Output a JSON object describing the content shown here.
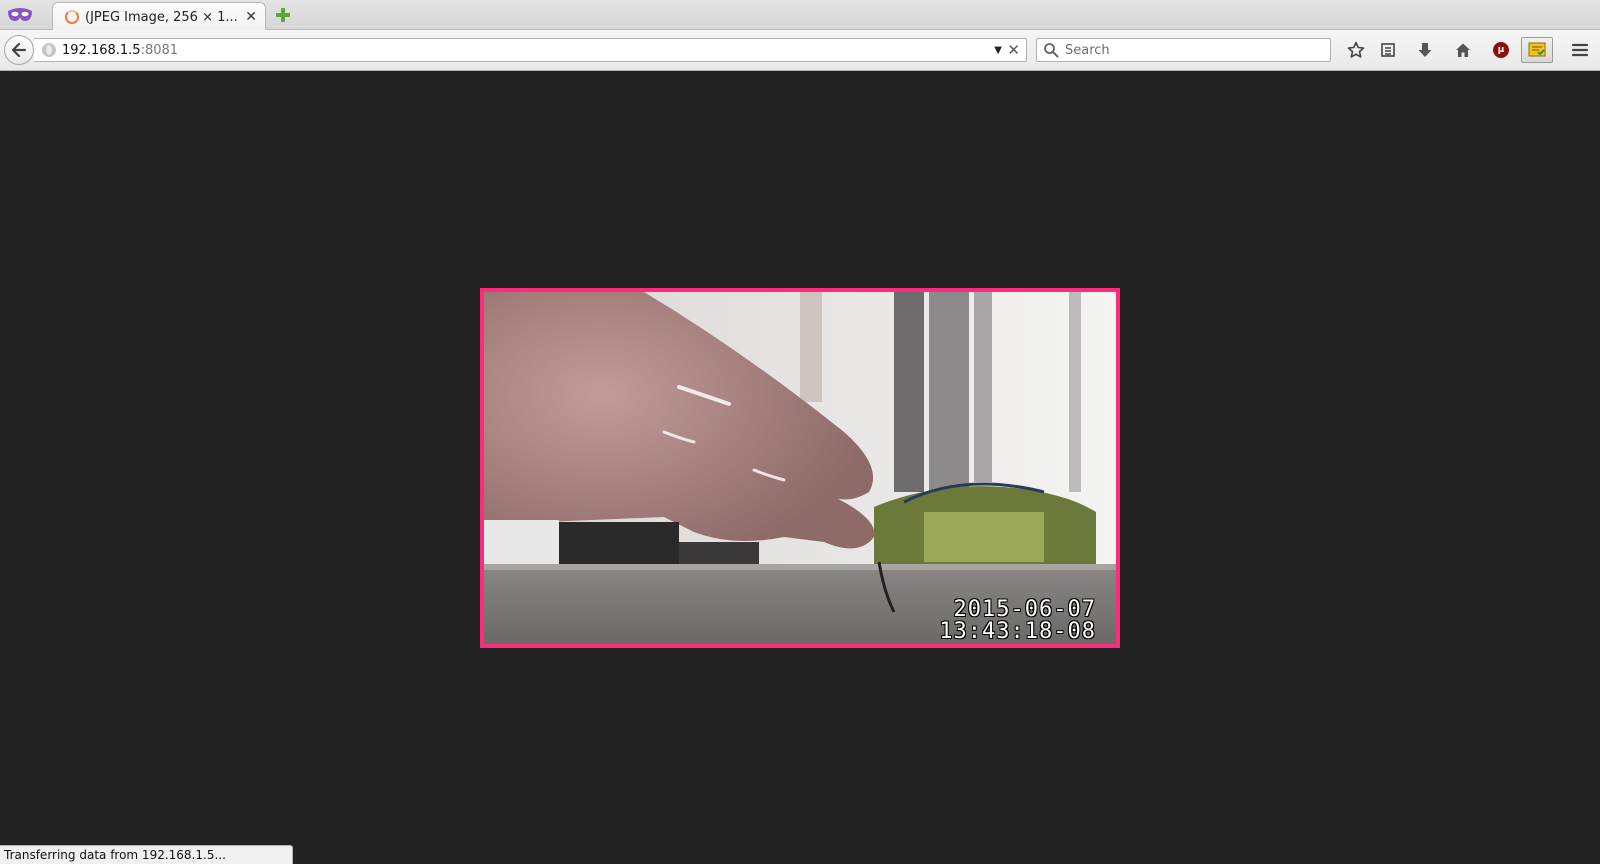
{
  "tab": {
    "title": "(JPEG Image, 256 × 1...",
    "close": "✕"
  },
  "urlbar": {
    "host": "192.168.1.5",
    "port": ":8081"
  },
  "search": {
    "placeholder": "Search"
  },
  "toolbar": {
    "icons": [
      "bookmark-star-icon",
      "reader-list-icon",
      "download-icon",
      "home-icon",
      "ublock-icon",
      "addon-icon",
      "menu-icon"
    ],
    "ublock_label": "μ"
  },
  "camera": {
    "date": "2015-06-07",
    "time": "13:43:18-08",
    "border_color": "#ff2a7a"
  },
  "status": {
    "text": "Transferring data from 192.168.1.5..."
  },
  "colors": {
    "page_bg": "#222222",
    "throbber": "#f07a32"
  }
}
